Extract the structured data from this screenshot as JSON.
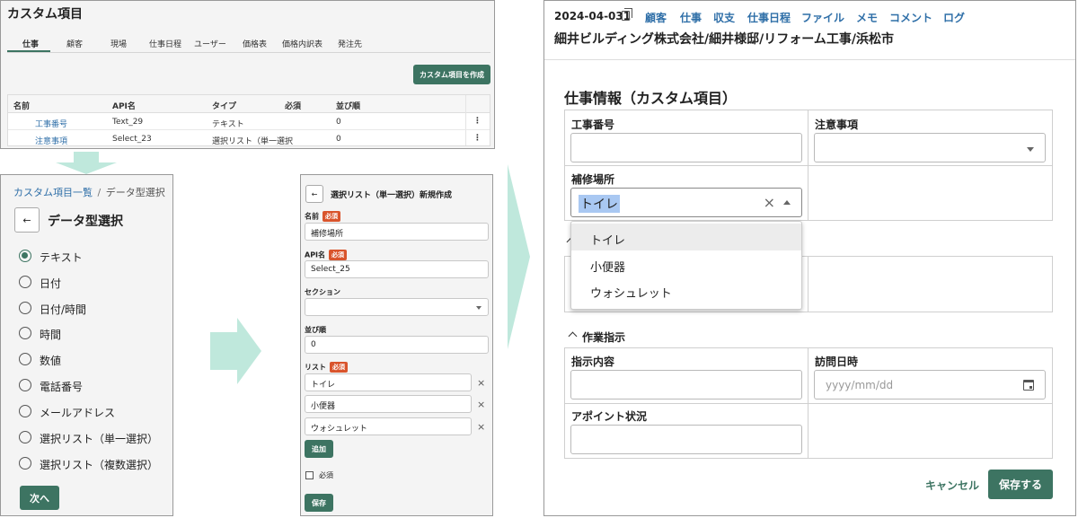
{
  "panel1": {
    "title": "カスタム項目",
    "tabs": [
      "仕事",
      "顧客",
      "現場",
      "仕事日程",
      "ユーザー",
      "価格表",
      "価格内訳表",
      "発注先"
    ],
    "create_button": "カスタム項目を作成",
    "columns": [
      "名前",
      "API名",
      "タイプ",
      "必須",
      "並び順"
    ],
    "rows": [
      {
        "name": "工事番号",
        "api": "Text_29",
        "type": "テキスト",
        "required": "",
        "order": "0"
      },
      {
        "name": "注意事項",
        "api": "Select_23",
        "type": "選択リスト（単一選択",
        "required": "",
        "order": "0"
      }
    ],
    "row_menu": "⋮"
  },
  "panel2": {
    "breadcrumb_link": "カスタム項目一覧",
    "breadcrumb_sep": "/",
    "breadcrumb_current": "データ型選択",
    "back": "←",
    "title": "データ型選択",
    "options": [
      "テキスト",
      "日付",
      "日付/時間",
      "時間",
      "数値",
      "電話番号",
      "メールアドレス",
      "選択リスト（単一選択）",
      "選択リスト（複数選択）"
    ],
    "selected_index": 0,
    "next_button": "次へ"
  },
  "panel3": {
    "back": "←",
    "title": "選択リスト（単一選択）新規作成",
    "required_badge": "必須",
    "name_label": "名前",
    "name_value": "補修場所",
    "api_label": "API名",
    "api_value": "Select_25",
    "section_label": "セクション",
    "section_value": "",
    "order_label": "並び順",
    "order_value": "0",
    "list_label": "リスト",
    "list_items": [
      "トイレ",
      "小便器",
      "ウォシュレット"
    ],
    "remove_icon": "×",
    "add_button": "追加",
    "required_checkbox_label": "必須",
    "save_button": "保存"
  },
  "panel4": {
    "job_id": "2024-04-031",
    "nav": [
      "顧客",
      "仕事",
      "収支",
      "仕事日程",
      "ファイル",
      "メモ",
      "コメント",
      "ログ"
    ],
    "job_path": "細井ビルディング株式会社/細井様邸/リフォーム工事/浜松市",
    "section_title": "仕事情報（カスタム項目）",
    "field_koji_label": "工事番号",
    "field_chui_label": "注意事項",
    "field_hoshu_label": "補修場所",
    "field_hoshu_value": "トイレ",
    "dropdown_options": [
      "トイレ",
      "小便器",
      "ウォシュレット"
    ],
    "section2_title": "作業指示",
    "field_shiji_label": "指示内容",
    "field_homon_label": "訪問日時",
    "field_homon_placeholder": "yyyy/mm/dd",
    "field_appoint_label": "アポイント状況",
    "cancel_button": "キャンセル",
    "save_button": "保存する"
  },
  "colors": {
    "accent_green": "#3d7462",
    "link_blue": "#2f6fa8",
    "arrow": "#bfe8dc",
    "badge": "#d9542c"
  }
}
